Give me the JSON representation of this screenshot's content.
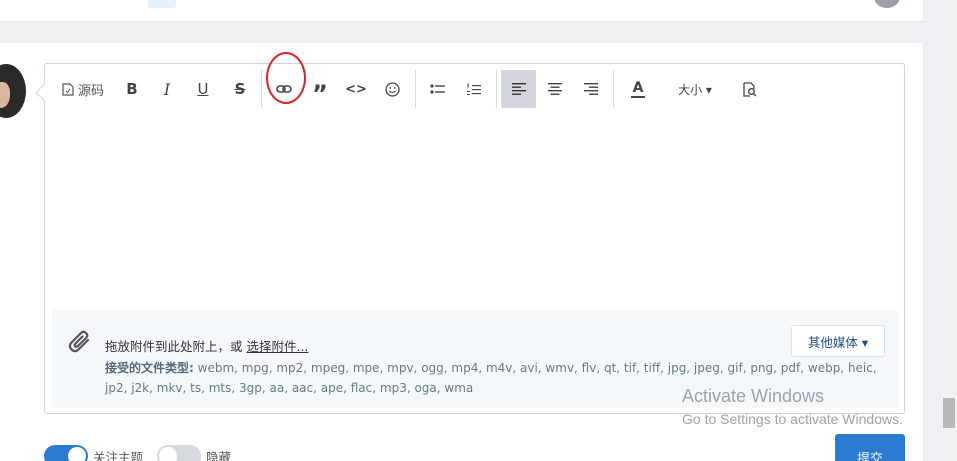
{
  "toolbar": {
    "source_label": "源码",
    "bold_label": "B",
    "italic_label": "I",
    "underline_label": "U",
    "strike_label": "S",
    "quote_label": "”",
    "code_label": "<>",
    "font_color_label": "A",
    "size_label": "大小 ▾"
  },
  "attachments": {
    "drop_text": "拖放附件到此处附上，或 ",
    "select_link": "选择附件...",
    "types_label": "接受的文件类型:",
    "types_list": "webm, mpg, mp2, mpeg, mpe, mpv, ogg, mp4, m4v, avi, wmv, flv, qt, tif, tiff, jpg, jpeg, gif, png, pdf, webp, heic, jp2, j2k, mkv, ts, mts, 3gp, aa, aac, ape, flac, mp3, oga, wma",
    "other_media_label": "其他媒体 ▾"
  },
  "watermark": {
    "line1": "Activate Windows",
    "line2": "Go to Settings to activate Windows."
  },
  "footer": {
    "follow_label": "关注主题",
    "hide_label": "隐藏",
    "submit_label": "提交"
  },
  "colors": {
    "accent": "#2b7bd3",
    "annotation": "#e02020"
  }
}
